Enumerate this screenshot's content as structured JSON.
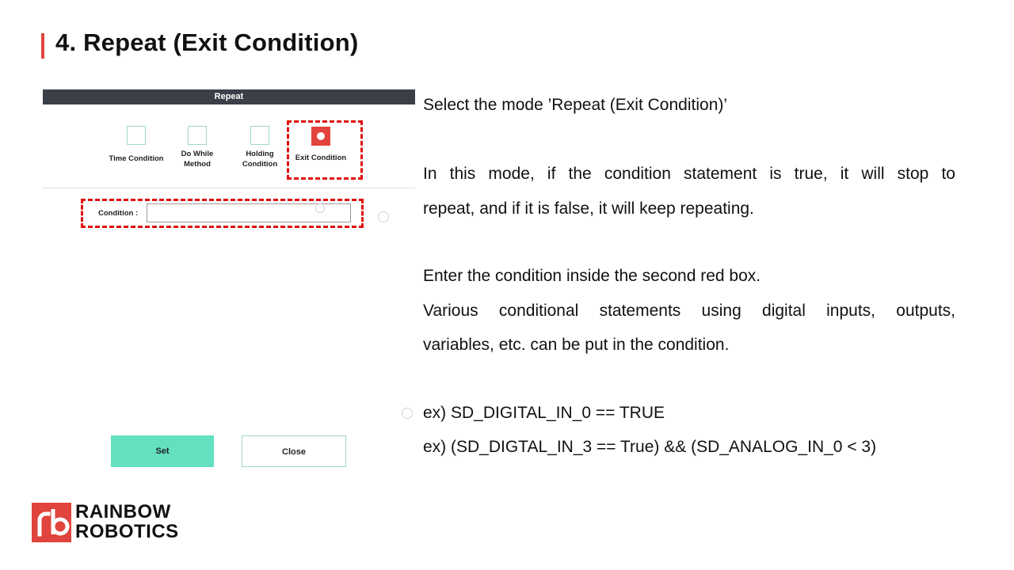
{
  "slide": {
    "title": "4. Repeat (Exit Condition)"
  },
  "dialog": {
    "header": "Repeat",
    "modes": [
      {
        "label_line1": "Time Condition",
        "label_line2": "",
        "selected": false
      },
      {
        "label_line1": "Do While",
        "label_line2": "Method",
        "selected": false
      },
      {
        "label_line1": "Holding",
        "label_line2": "Condition",
        "selected": false
      },
      {
        "label_line1": "Exit Condition",
        "label_line2": "",
        "selected": true
      }
    ],
    "condition_label": "Condition :",
    "condition_value": "",
    "set_label": "Set",
    "close_label": "Close"
  },
  "description": {
    "line1": "Select the mode ’Repeat (Exit Condition)’",
    "para2_line1": "In this mode, if the condition statement is true, it will stop to",
    "para2_line2": "repeat, and if it is false, it will keep repeating.",
    "para3_line1": "Enter the condition inside the second red box.",
    "para3_line2": "Various conditional statements using digital inputs, outputs,",
    "para3_line3": "variables, etc. can be put in the condition.",
    "example1": "ex) SD_DIGITAL_IN_0 == TRUE",
    "example2": "ex) (SD_DIGTAL_IN_3 == True) && (SD_ANALOG_IN_0 < 3)"
  },
  "logo": {
    "line1": "RAINBOW",
    "line2": "ROBOTICS"
  },
  "colors": {
    "accent": "#e0443c",
    "dashed_highlight": "#e01010",
    "set_button": "#63e0c0",
    "header": "#3a3f48"
  }
}
